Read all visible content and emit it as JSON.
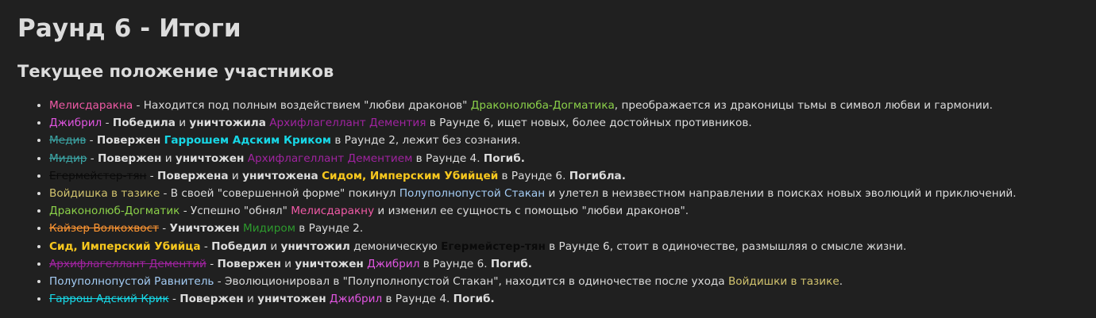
{
  "page": {
    "title": "Раунд 6 - Итоги",
    "subtitle": "Текущее положение участников"
  },
  "colors": {
    "pink": "#f05aa6",
    "green": "#8bd149",
    "purple": "#a023a0",
    "cyan": "#17d7e6",
    "teal": "#3ca5a5",
    "gold": "#f8c81e",
    "khaki": "#d2c36e",
    "lightblue": "#a5cdf5",
    "darkgreen": "#2d9a2d",
    "orange": "#ff9632",
    "magenta": "#e155e1",
    "black": "#0a0a0a",
    "text": "#dcdcdc"
  },
  "items": [
    {
      "segments": [
        {
          "text": "Мелисдаракна",
          "color": "pink"
        },
        {
          "text": " - Находится под полным воздействием \"любви драконов\" "
        },
        {
          "text": "Драконолюба-Догматика",
          "color": "green"
        },
        {
          "text": ", преображается из драконицы тьмы в символ любви и гармонии."
        }
      ]
    },
    {
      "segments": [
        {
          "text": "Джибрил",
          "color": "magenta"
        },
        {
          "text": " - "
        },
        {
          "text": "Победила",
          "bold": true
        },
        {
          "text": " и "
        },
        {
          "text": "уничтожила",
          "bold": true
        },
        {
          "text": " "
        },
        {
          "text": "Архифлагеллант Дементия",
          "color": "purple"
        },
        {
          "text": " в Раунде 6, ищет новых, более достойных противников."
        }
      ]
    },
    {
      "segments": [
        {
          "text": "Медив",
          "color": "teal",
          "strike": true
        },
        {
          "text": " - "
        },
        {
          "text": "Повержен",
          "bold": true
        },
        {
          "text": " "
        },
        {
          "text": "Гаррошем Адским Криком",
          "color": "cyan",
          "bold": true
        },
        {
          "text": " в Раунде 2, лежит без сознания."
        }
      ]
    },
    {
      "segments": [
        {
          "text": "Мидир",
          "color": "teal",
          "strike": true
        },
        {
          "text": " - "
        },
        {
          "text": "Повержен",
          "bold": true
        },
        {
          "text": " и "
        },
        {
          "text": "уничтожен",
          "bold": true
        },
        {
          "text": " "
        },
        {
          "text": "Архифлагеллант Дементием",
          "color": "purple"
        },
        {
          "text": " в Раунде 4. "
        },
        {
          "text": "Погиб.",
          "bold": true
        }
      ]
    },
    {
      "segments": [
        {
          "text": "Егермейстер-тян",
          "color": "black",
          "strike": true
        },
        {
          "text": " - "
        },
        {
          "text": "Повержена",
          "bold": true
        },
        {
          "text": " и "
        },
        {
          "text": "уничтожена",
          "bold": true
        },
        {
          "text": " "
        },
        {
          "text": "Сидом, Имперским Убийцей",
          "color": "gold",
          "bold": true
        },
        {
          "text": " в Раунде 6. "
        },
        {
          "text": "Погибла.",
          "bold": true
        }
      ]
    },
    {
      "segments": [
        {
          "text": "Войдишка в тазике",
          "color": "khaki"
        },
        {
          "text": " - В своей \"совершенной форме\" покинул "
        },
        {
          "text": "Полуполнопустой Стакан",
          "color": "lightblue"
        },
        {
          "text": " и улетел в неизвестном направлении в поисках новых эволюций и приключений."
        }
      ]
    },
    {
      "segments": [
        {
          "text": "Драконолюб-Догматик",
          "color": "green"
        },
        {
          "text": " - Успешно \"обнял\" "
        },
        {
          "text": "Мелисдаракну",
          "color": "pink"
        },
        {
          "text": " и изменил ее сущность с помощью \"любви драконов\"."
        }
      ]
    },
    {
      "segments": [
        {
          "text": "Кайзер Волкохвост",
          "color": "orange",
          "strike": true
        },
        {
          "text": " - "
        },
        {
          "text": "Уничтожен",
          "bold": true
        },
        {
          "text": " "
        },
        {
          "text": "Мидиром",
          "color": "darkgreen"
        },
        {
          "text": " в Раунде 2."
        }
      ]
    },
    {
      "segments": [
        {
          "text": "Сид, Имперский Убийца",
          "color": "gold",
          "bold": true
        },
        {
          "text": " - "
        },
        {
          "text": "Победил",
          "bold": true
        },
        {
          "text": " и "
        },
        {
          "text": "уничтожил",
          "bold": true
        },
        {
          "text": " демоническую "
        },
        {
          "text": "Егермейстер-тян",
          "color": "black",
          "bold": true
        },
        {
          "text": " в Раунде 6, стоит в одиночестве, размышляя о смысле жизни."
        }
      ]
    },
    {
      "segments": [
        {
          "text": "Архифлагеллант Дементий",
          "color": "purple",
          "strike": true
        },
        {
          "text": " - "
        },
        {
          "text": "Повержен",
          "bold": true
        },
        {
          "text": " и "
        },
        {
          "text": "уничтожен",
          "bold": true
        },
        {
          "text": " "
        },
        {
          "text": "Джибрил",
          "color": "magenta"
        },
        {
          "text": " в Раунде 6. "
        },
        {
          "text": "Погиб.",
          "bold": true
        }
      ]
    },
    {
      "segments": [
        {
          "text": "Полуполнопустой Равнитель",
          "color": "lightblue"
        },
        {
          "text": " - Эволюционировал в \"Полуполнопустой Стакан\", находится в одиночестве после ухода "
        },
        {
          "text": "Войдишки в тазике",
          "color": "khaki"
        },
        {
          "text": "."
        }
      ]
    },
    {
      "segments": [
        {
          "text": "Гаррош Адский Крик",
          "color": "cyan",
          "strike": true
        },
        {
          "text": " - "
        },
        {
          "text": "Повержен",
          "bold": true
        },
        {
          "text": " и "
        },
        {
          "text": "уничтожен",
          "bold": true
        },
        {
          "text": " "
        },
        {
          "text": "Джибрил",
          "color": "magenta"
        },
        {
          "text": " в Раунде 4. "
        },
        {
          "text": "Погиб.",
          "bold": true
        }
      ]
    }
  ]
}
